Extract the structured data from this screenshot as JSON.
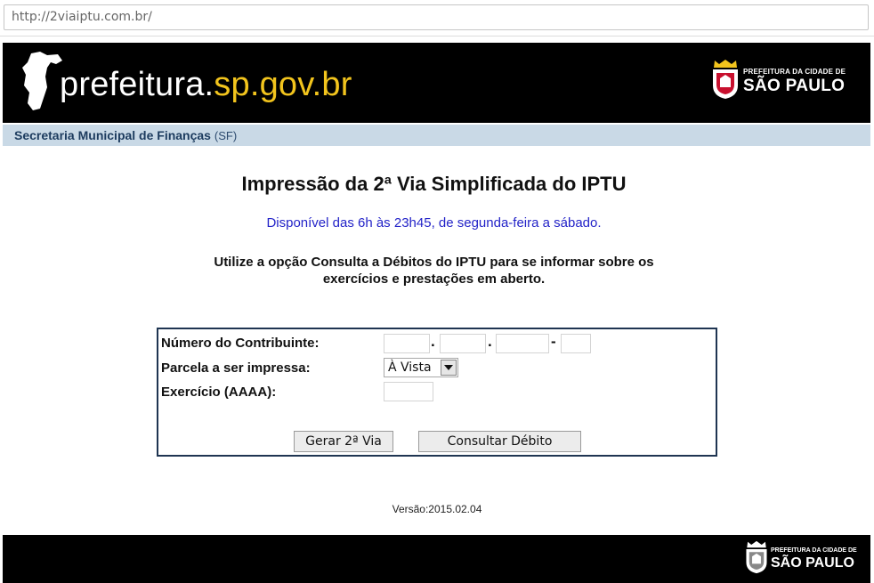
{
  "browser": {
    "url": "http://2viaiptu.com.br/"
  },
  "header": {
    "brand_part1": "prefeitura.",
    "brand_part2": "sp.gov.br",
    "pref_small": "PREFEITURA DA CIDADE DE",
    "pref_big": "SÃO PAULO"
  },
  "subbar": {
    "label": "Secretaria Municipal de Finanças",
    "abbr": "(SF)"
  },
  "main": {
    "title": "Impressão da 2ª Via Simplificada do IPTU",
    "availability": "Disponível das 6h às 23h45, de segunda-feira a sábado.",
    "note_line1": "Utilize a opção Consulta a Débitos do IPTU para se informar sobre os",
    "note_line2": "exercícios e prestações em aberto."
  },
  "form": {
    "contribuinte_label": "Número do Contribuinte:",
    "parcela_label": "Parcela a ser impressa:",
    "exercicio_label": "Exercício (AAAA):",
    "parcela_selected": "À Vista",
    "sep_dot": ".",
    "sep_dash": "-",
    "gerar_button": "Gerar 2ª Via",
    "consultar_button": "Consultar Débito"
  },
  "version": "Versão:2015.02.04",
  "footer": {
    "pref_small": "PREFEITURA DA CIDADE DE",
    "pref_big": "SÃO PAULO"
  },
  "colors": {
    "header_bg": "#000000",
    "brand_yellow": "#f2c41d",
    "subbar_bg": "#c9d9e6",
    "availability_blue": "#2323c8",
    "form_border": "#1f3552"
  }
}
